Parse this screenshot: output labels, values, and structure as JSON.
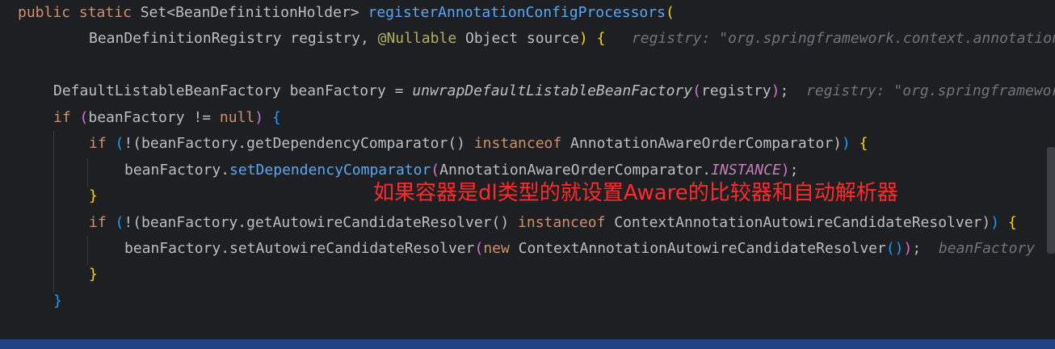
{
  "code": {
    "line1": {
      "kw": "public static ",
      "type": "Set<BeanDefinitionHolder> ",
      "method": "registerAnnotationConfigProcessors",
      "paren": "("
    },
    "line2": {
      "text": "BeanDefinitionRegistry registry, ",
      "annotation": "@Nullable",
      "text2": " Object source",
      "paren": ")",
      "brace": " {",
      "hint": "registry: \"org.springframework.context.annotation"
    },
    "line4": {
      "text": "DefaultListableBeanFactory beanFactory = ",
      "call": "unwrapDefaultListableBeanFactory",
      "open": "(",
      "arg": "registry",
      "close": ")",
      "semi": ";",
      "hint": "registry: \"org.springframework"
    },
    "line5": {
      "kw": "if ",
      "open": "(",
      "text": "beanFactory != ",
      "nullkw": "null",
      "close": ")",
      "brace": " {"
    },
    "line6": {
      "kw": "if ",
      "open": "(",
      "text": "!(beanFactory.getDependencyComparator() ",
      "kw2": "instanceof",
      "text2": " AnnotationAwareOrderComparator)",
      "close": ")",
      "brace": " {"
    },
    "line7": {
      "text": "beanFactory.",
      "method": "setDependencyComparator",
      "open": "(",
      "text2": "AnnotationAwareOrderComparator.",
      "static": "INSTANCE",
      "close": ")",
      "semi": ";"
    },
    "line8": {
      "brace": "}"
    },
    "line9": {
      "kw": "if ",
      "open": "(",
      "text": "!(beanFactory.getAutowireCandidateResolver() ",
      "kw2": "instanceof",
      "text2": " ContextAnnotationAutowireCandidateResolver)",
      "close": ")",
      "brace": " {"
    },
    "line10": {
      "text": "beanFactory.setAutowireCandidateResolver",
      "open": "(",
      "kw": "new",
      "text2": " ContextAnnotationAutowireCandidateResolver",
      "inner": "()",
      "close": ")",
      "semi": ";",
      "hint": "beanFactory"
    },
    "line11": {
      "brace": "}"
    },
    "line12": {
      "brace": "}"
    }
  },
  "annotation_overlay": "如果容器是dl类型的就设置Aware的比较器和自动解析器",
  "colors": {
    "background": "#1e1f22",
    "keyword": "#cf8e6d",
    "method": "#56a8f5",
    "annotation": "#b3ae60",
    "hint": "#6f737a",
    "static_field": "#c77dbb",
    "overlay_text": "#ff2a2a",
    "selection_bar": "#214283"
  }
}
